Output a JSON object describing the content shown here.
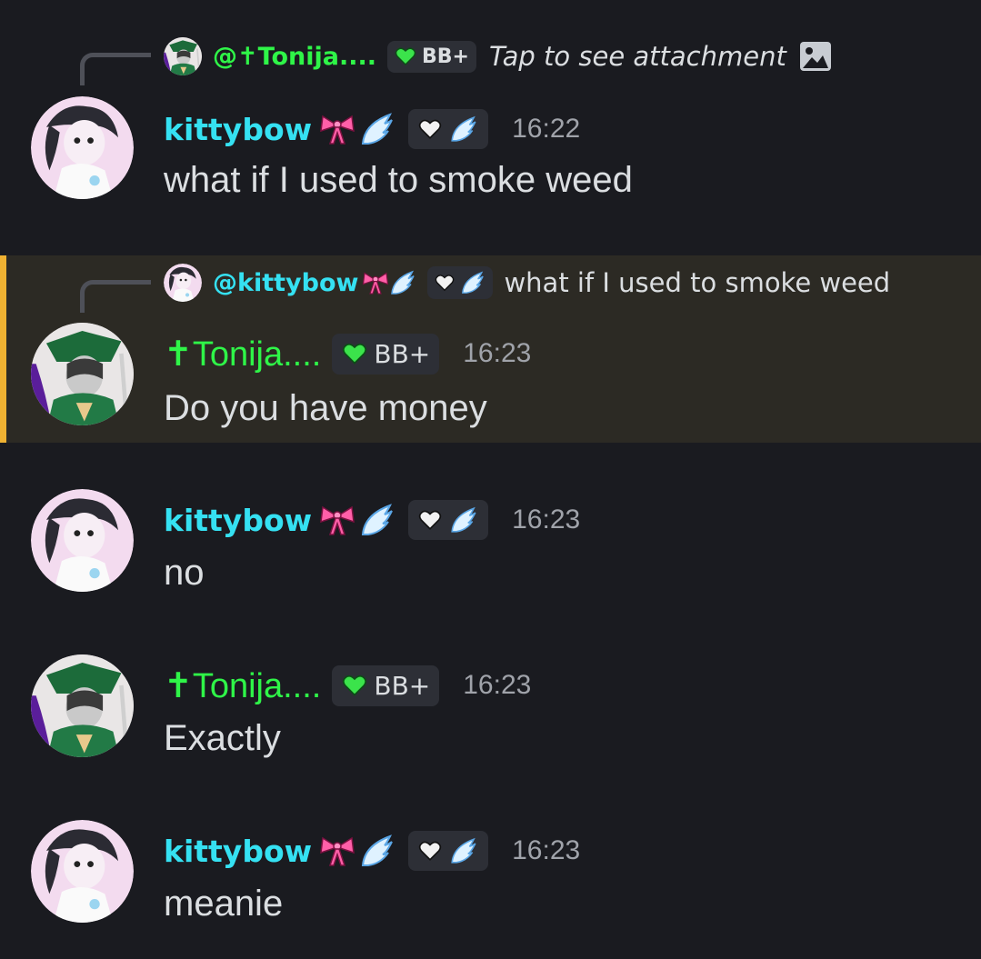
{
  "messages": [
    {
      "reply": {
        "name": "@✝Tonija....",
        "tag": "BB+",
        "text": "Tap to see attachment"
      },
      "author": "kittybow",
      "time": "16:22",
      "text": "what if I used to smoke weed"
    },
    {
      "reply": {
        "name": "@kittybow",
        "text": "what if I used to smoke weed"
      },
      "author": "✝Tonija....",
      "tag": "BB+",
      "time": "16:23",
      "text": "Do you have money"
    },
    {
      "author": "kittybow",
      "time": "16:23",
      "text": "no"
    },
    {
      "author": "✝Tonija....",
      "tag": "BB+",
      "time": "16:23",
      "text": "Exactly"
    },
    {
      "author": "kittybow",
      "time": "16:23",
      "text": "meanie"
    }
  ],
  "colors": {
    "cyan_name": "#35e1f2",
    "green_name": "#2ff548",
    "highlight_bar": "#f0b232",
    "background": "#1a1b20"
  }
}
